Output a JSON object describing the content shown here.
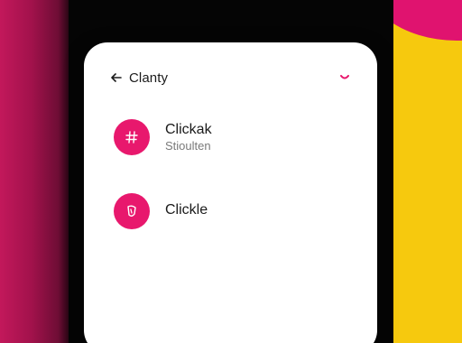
{
  "header": {
    "title": "Clanty",
    "back_icon": "arrow-left-icon",
    "menu_icon": "chevron-down-icon"
  },
  "items": [
    {
      "title": "Clickak",
      "subtitle": "Stioulten",
      "icon": "hash-icon"
    },
    {
      "title": "Clickle",
      "icon": "shield-icon"
    }
  ],
  "colors": {
    "accent": "#e8186d",
    "left_band": "#a3124c",
    "right_band": "#f6c90e",
    "right_arc": "#e0136f",
    "card": "#ffffff"
  }
}
